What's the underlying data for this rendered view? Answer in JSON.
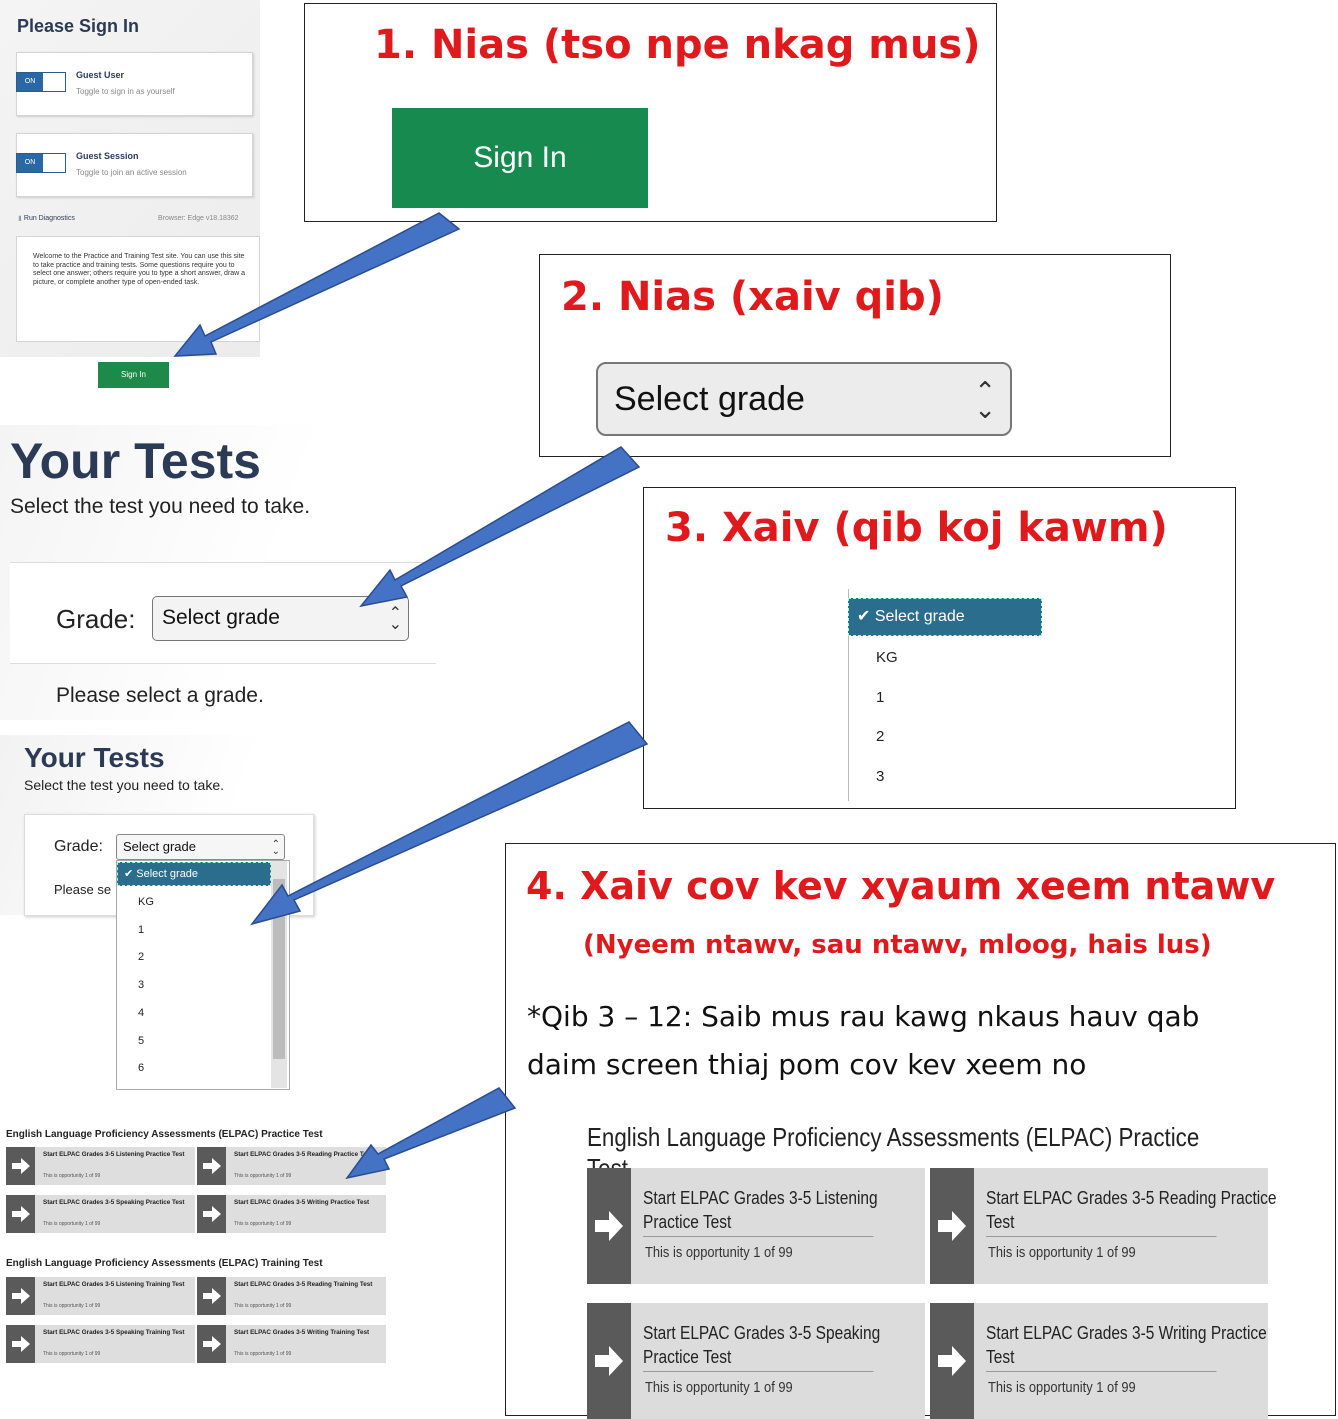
{
  "signin": {
    "title": "Please Sign In",
    "guest_user": {
      "toggle": "ON",
      "title": "Guest User",
      "subtitle": "Toggle to sign in as yourself"
    },
    "guest_session": {
      "toggle": "ON",
      "title": "Guest Session",
      "subtitle": "Toggle to join an active session"
    },
    "diagnostics": "Run Diagnostics",
    "browser": "Browser: Edge v18.18362",
    "welcome": "Welcome to the Practice and Training Test site. You can use this site to take practice and training tests. Some questions require you to select one answer; others require you to type a short answer, draw a picture, or complete another type of open-ended task.",
    "button": "Sign In"
  },
  "step1": {
    "title": "1.  Nias (tso npe nkag mus)",
    "button": "Sign In"
  },
  "step2": {
    "title": "2.  Nias (xaiv qib)",
    "select": "Select grade"
  },
  "step3": {
    "title": "3.  Xaiv (qib koj kawm)",
    "selected": "Select grade",
    "options": [
      "KG",
      "1",
      "2",
      "3"
    ]
  },
  "step4": {
    "title": "4.  Xaiv cov kev xyaum xeem ntawv",
    "subtitle": "(Nyeem ntawv, sau ntawv, mloog, hais lus)",
    "note_line1": "*Qib 3 – 12: Saib mus rau kawg nkaus hauv qab",
    "note_line2": "daim screen thiaj pom cov kev xeem no",
    "practice_heading": "English Language Proficiency Assessments (ELPAC) Practice Test",
    "tests": [
      {
        "line1": "Start ELPAC Grades 3-5 Listening",
        "line2": "Practice Test",
        "opportunity": "This is opportunity 1 of 99"
      },
      {
        "line1": "Start ELPAC Grades 3-5 Reading Practice",
        "line2": "Test",
        "opportunity": "This is opportunity 1 of 99"
      },
      {
        "line1": "Start ELPAC Grades 3-5 Speaking",
        "line2": "Practice Test",
        "opportunity": "This is opportunity 1 of 99"
      },
      {
        "line1": "Start ELPAC Grades 3-5 Writing Practice",
        "line2": "Test",
        "opportunity": "This is opportunity 1 of 99"
      }
    ]
  },
  "tests_large": {
    "title": "Your Tests",
    "subtitle": "Select the test you need to take.",
    "grade_label": "Grade:",
    "select": "Select grade",
    "prompt": "Please select a grade."
  },
  "tests_small": {
    "title": "Your Tests",
    "subtitle": "Select the test you need to take.",
    "grade_label": "Grade:",
    "select": "Select grade",
    "prompt": "Please se",
    "selected": "Select grade",
    "options": [
      "KG",
      "1",
      "2",
      "3",
      "4",
      "5",
      "6"
    ]
  },
  "elpac_small": {
    "practice_heading": "English Language Proficiency Assessments (ELPAC) Practice Test",
    "practice": [
      {
        "title": "Start ELPAC Grades 3-5 Listening Practice Test",
        "opportunity": "This is opportunity 1 of 99"
      },
      {
        "title": "Start ELPAC Grades 3-5 Reading Practice Test",
        "opportunity": "This is opportunity 1 of 99"
      },
      {
        "title": "Start ELPAC Grades 3-5 Speaking Practice Test",
        "opportunity": "This is opportunity 1 of 99"
      },
      {
        "title": "Start ELPAC Grades 3-5 Writing Practice Test",
        "opportunity": "This is opportunity 1 of 99"
      }
    ],
    "training_heading": "English Language Proficiency Assessments (ELPAC) Training Test",
    "training": [
      {
        "title": "Start ELPAC Grades 3-5 Listening Training Test",
        "opportunity": "This is opportunity 1 of 99"
      },
      {
        "title": "Start ELPAC Grades 3-5 Reading Training Test",
        "opportunity": "This is opportunity 1 of 99"
      },
      {
        "title": "Start ELPAC Grades 3-5 Speaking Training Test",
        "opportunity": "This is opportunity 1 of 99"
      },
      {
        "title": "Start ELPAC Grades 3-5 Writing Training Test",
        "opportunity": "This is opportunity 1 of 99"
      }
    ]
  },
  "colors": {
    "callout_text": "#e0191c",
    "arrow": "#4472c4",
    "green": "#178a4f",
    "select_highlight": "#2a6d8c"
  }
}
